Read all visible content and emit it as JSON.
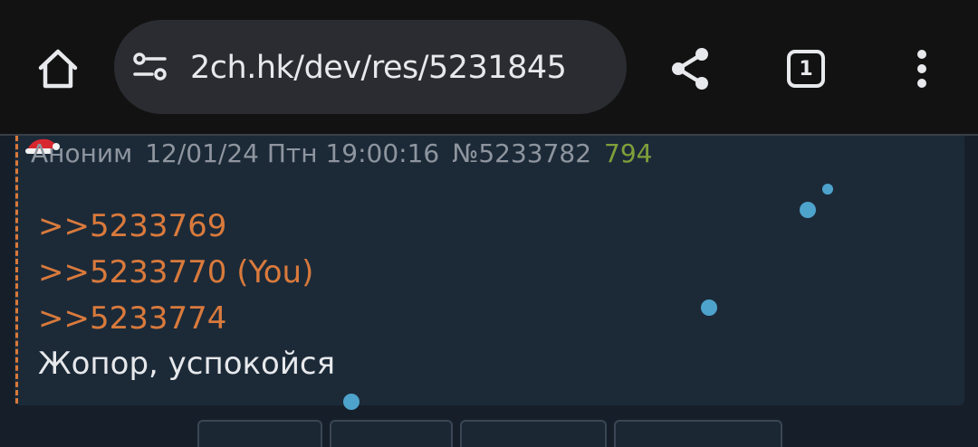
{
  "browser": {
    "url": "2ch.hk/dev/res/5231845",
    "tab_count": "1",
    "icons": {
      "home": "home-icon",
      "site_settings": "site-settings-icon",
      "share": "share-icon",
      "tabs": "tab-switcher-icon",
      "menu": "overflow-menu-icon"
    },
    "colors": {
      "toolbar_bg": "#121212",
      "urlbar_bg": "#2a2c31",
      "icon": "#e8e9ec"
    }
  },
  "post": {
    "author": "Аноним",
    "date": "12/01/24 Птн 19:00:16",
    "number": "№5233782",
    "replies_count": "794",
    "reply_links": [
      ">>5233769",
      ">>5233770 (You)",
      ">>5233774"
    ],
    "text": "Жопор, успокойся",
    "colors": {
      "background": "#1c2a38",
      "link": "#d97a3c",
      "meta": "#8e959e",
      "replies": "#7ea03a",
      "border": "#d9783a",
      "snow": "#4ea3cc"
    }
  }
}
